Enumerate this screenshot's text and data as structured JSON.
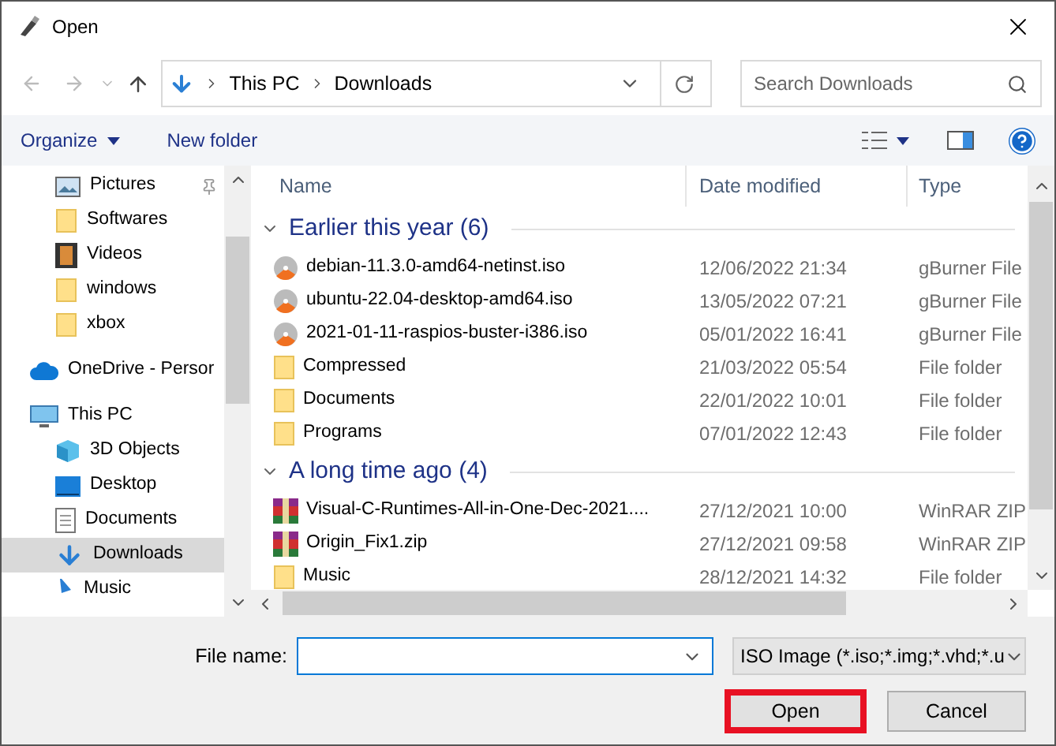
{
  "window": {
    "title": "Open"
  },
  "address": {
    "path": [
      "This PC",
      "Downloads"
    ],
    "search_placeholder": "Search Downloads"
  },
  "toolbar": {
    "organize": "Organize",
    "new_folder": "New folder"
  },
  "sidebar": {
    "items": [
      {
        "label": "Pictures",
        "kind": "pictures",
        "pinned": true,
        "selected": false
      },
      {
        "label": "Softwares",
        "kind": "folder",
        "pinned": false,
        "selected": false
      },
      {
        "label": "Videos",
        "kind": "videos",
        "pinned": false,
        "selected": false
      },
      {
        "label": "windows",
        "kind": "folder",
        "pinned": false,
        "selected": false
      },
      {
        "label": "xbox",
        "kind": "folder",
        "pinned": false,
        "selected": false
      },
      {
        "label": "OneDrive - Persor",
        "kind": "cloud",
        "pinned": false,
        "selected": false
      },
      {
        "label": "This PC",
        "kind": "pc",
        "pinned": false,
        "selected": false
      },
      {
        "label": "3D Objects",
        "kind": "cube",
        "pinned": false,
        "selected": false
      },
      {
        "label": "Desktop",
        "kind": "desktop",
        "pinned": false,
        "selected": false
      },
      {
        "label": "Documents",
        "kind": "document",
        "pinned": false,
        "selected": false
      },
      {
        "label": "Downloads",
        "kind": "download",
        "pinned": false,
        "selected": true
      },
      {
        "label": "Music",
        "kind": "music",
        "pinned": false,
        "selected": false
      }
    ]
  },
  "table": {
    "columns": [
      "Name",
      "Date modified",
      "Type"
    ],
    "groups": [
      {
        "title": "Earlier this year (6)",
        "expanded": true,
        "rows": [
          {
            "name": "debian-11.3.0-amd64-netinst.iso",
            "kind": "iso",
            "date": "12/06/2022 21:34",
            "type": "gBurner File"
          },
          {
            "name": "ubuntu-22.04-desktop-amd64.iso",
            "kind": "iso",
            "date": "13/05/2022 07:21",
            "type": "gBurner File"
          },
          {
            "name": "2021-01-11-raspios-buster-i386.iso",
            "kind": "iso",
            "date": "05/01/2022 16:41",
            "type": "gBurner File"
          },
          {
            "name": "Compressed",
            "kind": "folder",
            "date": "21/03/2022 05:54",
            "type": "File folder"
          },
          {
            "name": "Documents",
            "kind": "folder",
            "date": "22/01/2022 10:01",
            "type": "File folder"
          },
          {
            "name": "Programs",
            "kind": "folder",
            "date": "07/01/2022 12:43",
            "type": "File folder"
          }
        ]
      },
      {
        "title": "A long time ago (4)",
        "expanded": true,
        "rows": [
          {
            "name": "Visual-C-Runtimes-All-in-One-Dec-2021....",
            "kind": "archive",
            "date": "27/12/2021 10:00",
            "type": "WinRAR ZIP"
          },
          {
            "name": "Origin_Fix1.zip",
            "kind": "archive",
            "date": "27/12/2021 09:58",
            "type": "WinRAR ZIP"
          },
          {
            "name": "Music",
            "kind": "folder",
            "date": "28/12/2021 14:32",
            "type": "File folder"
          }
        ]
      }
    ]
  },
  "footer": {
    "file_name_label": "File name:",
    "file_type": "ISO Image (*.iso;*.img;*.vhd;*.u",
    "buttons": [
      {
        "label": "Open",
        "highlighted": true
      },
      {
        "label": "Cancel",
        "highlighted": false
      }
    ]
  }
}
